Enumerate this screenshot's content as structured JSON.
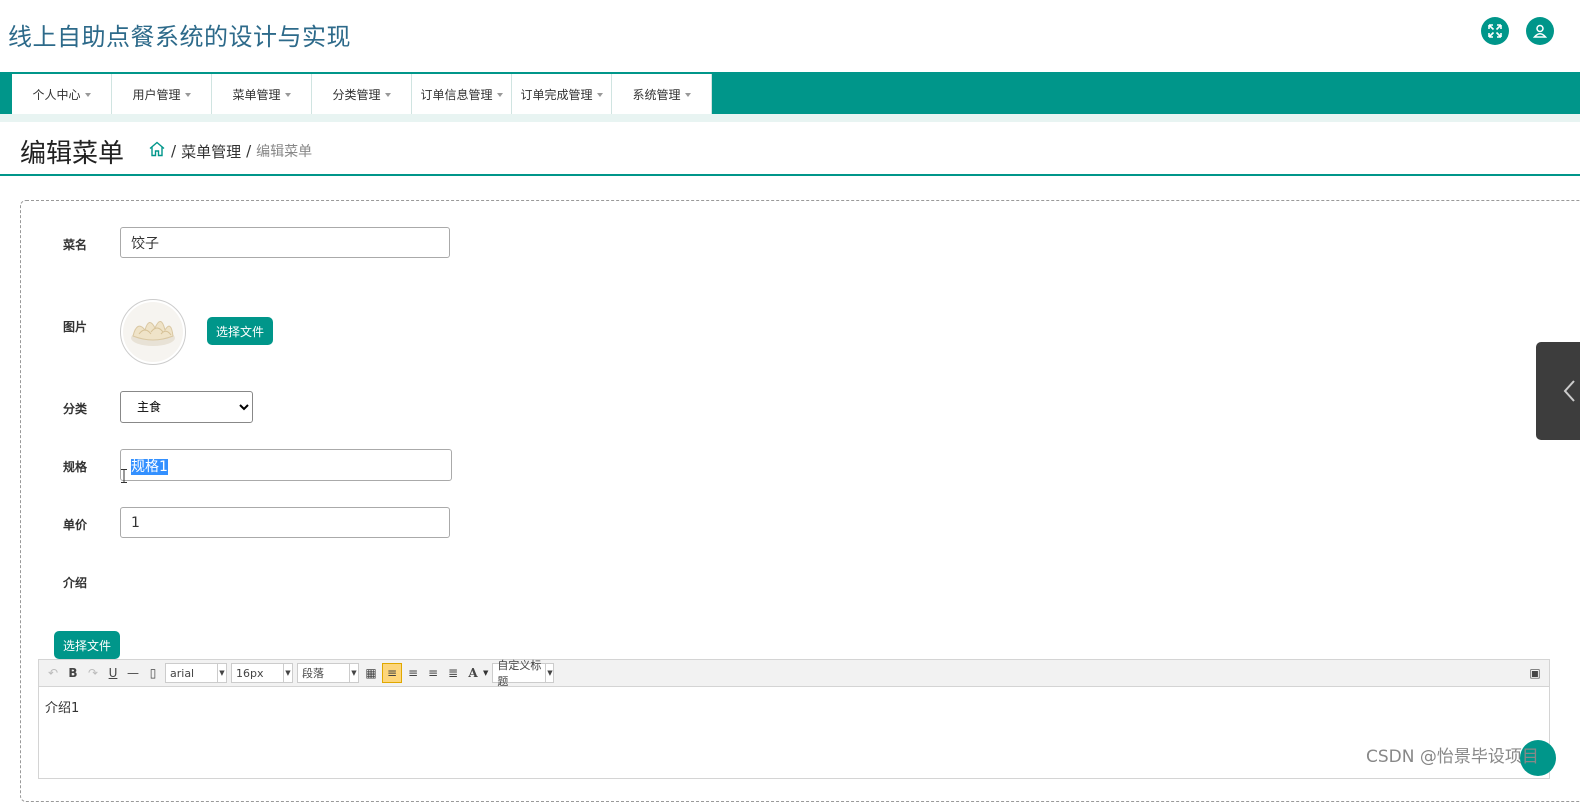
{
  "app_title": "线上自助点餐系统的设计与实现",
  "nav": [
    {
      "label": "个人中心"
    },
    {
      "label": "用户管理"
    },
    {
      "label": "菜单管理"
    },
    {
      "label": "分类管理"
    },
    {
      "label": "订单信息管理"
    },
    {
      "label": "订单完成管理"
    },
    {
      "label": "系统管理"
    }
  ],
  "page_title": "编辑菜单",
  "breadcrumb": {
    "sep": "/",
    "section": "菜单管理",
    "current": "编辑菜单"
  },
  "form": {
    "name_label": "菜名",
    "name_value": "饺子",
    "image_label": "图片",
    "choose_file": "选择文件",
    "category_label": "分类",
    "category_value": "主食",
    "spec_label": "规格",
    "spec_value": "规格1",
    "price_label": "单价",
    "price_value": "1",
    "intro_label": "介绍",
    "intro_choose_file": "选择文件"
  },
  "editor": {
    "font_family": "arial",
    "font_size": "16px",
    "paragraph": "段落",
    "custom_title": "自定义标题",
    "content": "介绍1"
  },
  "watermark": "CSDN @怡景毕设项目",
  "colors": {
    "primary": "#00968a",
    "title": "#2d6a8a"
  }
}
